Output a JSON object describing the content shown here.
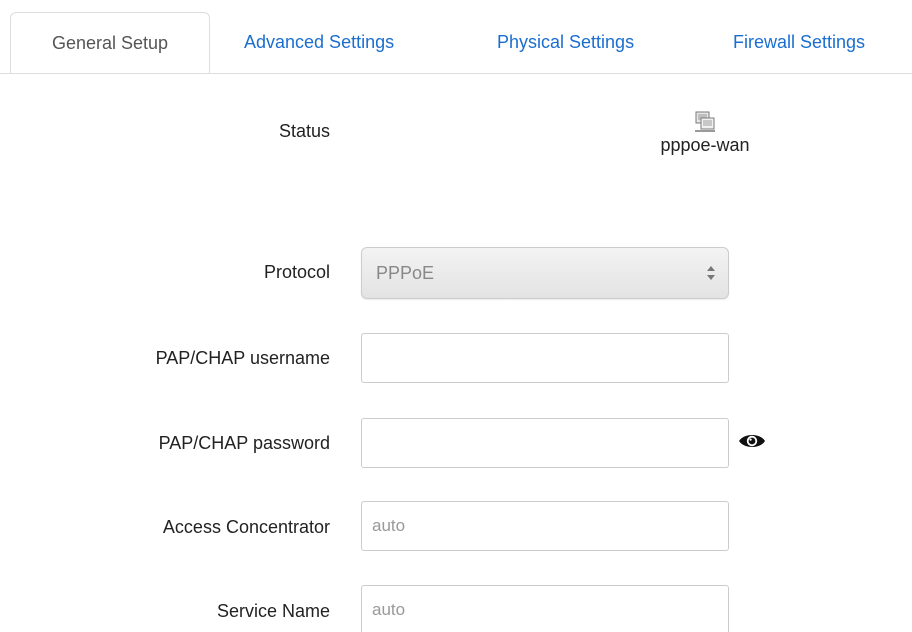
{
  "tabs": [
    {
      "label": "General Setup",
      "active": true
    },
    {
      "label": "Advanced Settings",
      "active": false
    },
    {
      "label": "Physical Settings",
      "active": false
    },
    {
      "label": "Firewall Settings",
      "active": false
    }
  ],
  "status": {
    "label": "Status",
    "interface_icon": "network-interface-icon",
    "interface_name": "pppoe-wan"
  },
  "form": {
    "protocol": {
      "label": "Protocol",
      "value": "PPPoE"
    },
    "username": {
      "label": "PAP/CHAP username",
      "value": "",
      "placeholder": ""
    },
    "password": {
      "label": "PAP/CHAP password",
      "value": "",
      "placeholder": "",
      "reveal_icon": "eye-icon"
    },
    "access_concentrator": {
      "label": "Access Concentrator",
      "value": "",
      "placeholder": "auto"
    },
    "service_name": {
      "label": "Service Name",
      "value": "",
      "placeholder": "auto"
    }
  },
  "colors": {
    "link": "#1a6ed0",
    "border": "#cccccc",
    "placeholder": "#999999"
  }
}
